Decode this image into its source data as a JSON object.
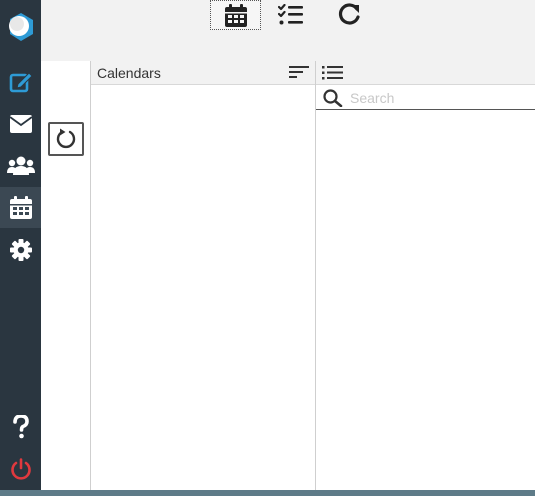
{
  "rail": {
    "items": [
      {
        "icon": "app-logo-icon"
      },
      {
        "icon": "compose-icon"
      },
      {
        "icon": "envelope-icon"
      },
      {
        "icon": "contacts-icon"
      },
      {
        "icon": "calendar-icon",
        "active": true
      },
      {
        "icon": "gear-icon"
      },
      {
        "icon": "help-icon"
      },
      {
        "icon": "power-icon"
      }
    ]
  },
  "toolbar": {
    "buttons": [
      {
        "icon": "calendar-icon",
        "selected": true
      },
      {
        "icon": "task-list-icon"
      },
      {
        "icon": "refresh-icon"
      }
    ]
  },
  "calendars": {
    "title": "Calendars"
  },
  "events": {
    "search_placeholder": "Search"
  },
  "colors": {
    "rail_bg": "#2a3640",
    "accent_blue": "#2e9bd6",
    "power_red": "#e0393e"
  }
}
